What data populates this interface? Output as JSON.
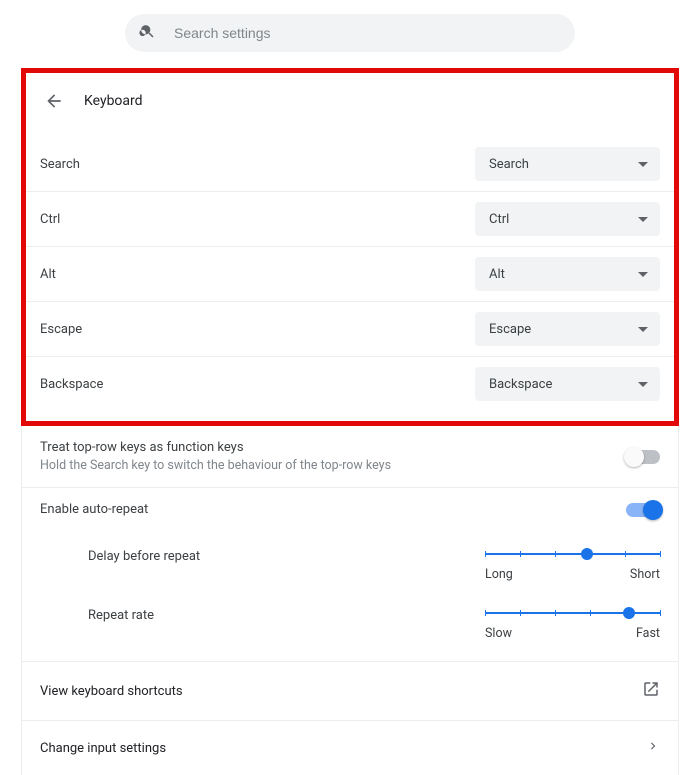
{
  "search": {
    "placeholder": "Search settings"
  },
  "header": {
    "title": "Keyboard"
  },
  "key_mappings": [
    {
      "label": "Search",
      "value": "Search"
    },
    {
      "label": "Ctrl",
      "value": "Ctrl"
    },
    {
      "label": "Alt",
      "value": "Alt"
    },
    {
      "label": "Escape",
      "value": "Escape"
    },
    {
      "label": "Backspace",
      "value": "Backspace"
    }
  ],
  "function_keys": {
    "title": "Treat top-row keys as function keys",
    "subtitle": "Hold the Search key to switch the behaviour of the top-row keys",
    "enabled": false
  },
  "auto_repeat": {
    "title": "Enable auto-repeat",
    "enabled": true,
    "delay": {
      "label": "Delay before repeat",
      "min_label": "Long",
      "max_label": "Short",
      "percent": 58
    },
    "rate": {
      "label": "Repeat rate",
      "min_label": "Slow",
      "max_label": "Fast",
      "percent": 82
    }
  },
  "shortcuts_label": "View keyboard shortcuts",
  "input_settings_label": "Change input settings"
}
